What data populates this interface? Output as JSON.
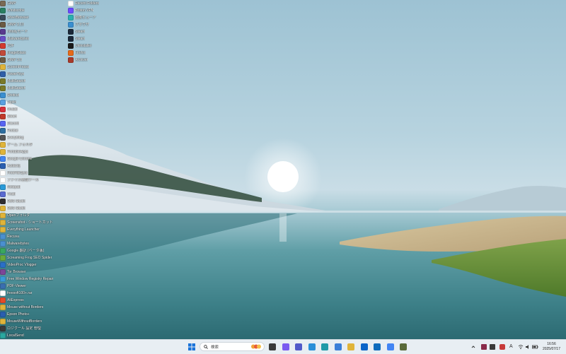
{
  "desktop": {
    "icons_col1": [
      {
        "label": "GIMP",
        "color": "#7a6a55",
        "icon": "gimp-icon"
      },
      {
        "label": "Windscribe",
        "color": "#2a7f62",
        "icon": "app-icon"
      },
      {
        "label": "SilverBrowser",
        "color": "#3a4a5a",
        "icon": "app-icon"
      },
      {
        "label": "GIMP 2.10",
        "color": "#6b5a44",
        "icon": "gimp-icon"
      },
      {
        "label": "Infinityモード",
        "color": "#5a3b8f",
        "icon": "app-icon"
      },
      {
        "label": "Malwarebytes",
        "color": "#6a4fc7",
        "icon": "app-icon"
      },
      {
        "label": "PDF",
        "color": "#d33b2f",
        "icon": "pdf-icon"
      },
      {
        "label": "ImageGlass",
        "color": "#c24a3a",
        "icon": "app-icon"
      },
      {
        "label": "GIMP 3.0",
        "color": "#6b5a44",
        "icon": "gimp-icon"
      },
      {
        "label": "ScreenPresso",
        "color": "#e0b43a",
        "icon": "folder-icon"
      },
      {
        "label": "PowerToys",
        "color": "#2f5fa8",
        "icon": "app-icon"
      },
      {
        "label": "MultiSearch",
        "color": "#7a7a2a",
        "icon": "app-icon"
      },
      {
        "label": "MultiSearch",
        "color": "#7a7a2a",
        "icon": "app-icon"
      },
      {
        "label": "Shotcut",
        "color": "#3a8fd0",
        "icon": "app-icon"
      },
      {
        "label": "Joplin",
        "color": "#5aa0e0",
        "icon": "app-icon"
      },
      {
        "label": "Vivaldi",
        "color": "#d8323c",
        "icon": "app-icon"
      },
      {
        "label": "Steam",
        "color": "#c0392b",
        "icon": "app-icon"
      },
      {
        "label": "Discord",
        "color": "#5865f2",
        "icon": "app-icon"
      },
      {
        "label": "Foobar",
        "color": "#2f6fa0",
        "icon": "app-icon"
      },
      {
        "label": "Everything",
        "color": "#555555",
        "icon": "app-icon"
      },
      {
        "label": "ゲーム フォルダ",
        "color": "#e0b43a",
        "icon": "folder-icon"
      },
      {
        "label": "PortableApps",
        "color": "#e0b43a",
        "icon": "folder-icon"
      },
      {
        "label": "Google Chrome",
        "color": "#4285f4",
        "icon": "chrome-icon"
      },
      {
        "label": "Audacity",
        "color": "#2a5fb0",
        "icon": "app-icon"
      },
      {
        "label": "FreeFileSync",
        "color": "#ffffff",
        "icon": "document-icon"
      },
      {
        "label": "ファイル管理ツール",
        "color": "#ffffff",
        "icon": "document-icon"
      },
      {
        "label": "Notepad",
        "color": "#2a9ad8",
        "icon": "app-icon"
      },
      {
        "label": "Tixati",
        "color": "#5a6ad0",
        "icon": "app-icon"
      },
      {
        "label": "OBS Studio",
        "color": "#302e31",
        "icon": "app-icon"
      },
      {
        "label": "OBS Studio",
        "color": "#e0b43a",
        "icon": "folder-icon"
      },
      {
        "label": "Openフォルダ",
        "color": "#e0b43a",
        "icon": "folder-icon"
      },
      {
        "label": "Screenshot - ショートカット",
        "color": "#e0b43a",
        "icon": "folder-icon"
      },
      {
        "label": "Everything Launcher",
        "color": "#e0b43a",
        "icon": "folder-icon"
      },
      {
        "label": "Recuva",
        "color": "#4a90d0",
        "icon": "app-icon"
      },
      {
        "label": "Malwarebytes",
        "color": "#4a90d0",
        "icon": "app-icon"
      },
      {
        "label": "Google 翻訳 (ベータ版)",
        "color": "#3aa860",
        "icon": "app-icon"
      },
      {
        "label": "Screaming Frog SEO Spider",
        "color": "#6aaa3a",
        "icon": "app-icon"
      },
      {
        "label": "VideoProc Vlogger",
        "color": "#2a6fc8",
        "icon": "app-icon"
      },
      {
        "label": "Tor Browser",
        "color": "#7d4698",
        "icon": "app-icon"
      },
      {
        "label": "Free Window Registry Repair",
        "color": "#3a9ad8",
        "icon": "app-icon"
      },
      {
        "label": "PDF-Viewer",
        "color": "#3a6fb0",
        "icon": "app-icon"
      },
      {
        "label": "freesoft100+.rar",
        "color": "#ffffff",
        "icon": "document-icon"
      },
      {
        "label": "AliExpress",
        "color": "#e64a2a",
        "icon": "app-icon"
      },
      {
        "label": "Mouse without Borders",
        "color": "#e0b43a",
        "icon": "folder-icon"
      },
      {
        "label": "Epson Photo+",
        "color": "#2a5fb0",
        "icon": "app-icon"
      },
      {
        "label": "MouseWithoutBorders",
        "color": "#e0b43a",
        "icon": "folder-icon"
      },
      {
        "label": "ロジクール 設定 管理",
        "color": "#3a3a3a",
        "icon": "app-icon"
      },
      {
        "label": "LocalSend",
        "color": "#2aa8a0",
        "icon": "app-icon"
      }
    ],
    "icons_col2": [
      {
        "label": "Recent Folders",
        "color": "#ffffff",
        "icon": "document-icon"
      },
      {
        "label": "Proton VPN",
        "color": "#6d4aff",
        "icon": "app-icon"
      },
      {
        "label": "画像ビューア",
        "color": "#2ab0b0",
        "icon": "app-icon"
      },
      {
        "label": "ブラウザ",
        "color": "#3a8fd0",
        "icon": "app-icon"
      },
      {
        "label": "Steam",
        "color": "#1b2838",
        "icon": "app-icon"
      },
      {
        "label": "Steam",
        "color": "#1b2838",
        "icon": "app-icon"
      },
      {
        "label": "Uninstaller",
        "color": "#1a1a1a",
        "icon": "app-icon"
      },
      {
        "label": "Firefox",
        "color": "#e66a1a",
        "icon": "app-icon"
      },
      {
        "label": "Archiver",
        "color": "#a83a2a",
        "icon": "app-icon"
      }
    ]
  },
  "taskbar": {
    "search_placeholder": "検索",
    "apps": [
      {
        "icon": "file-explorer-icon",
        "color": "#3a3a3a"
      },
      {
        "icon": "copilot-icon",
        "color": "#7a5af0"
      },
      {
        "icon": "teams-icon",
        "color": "#5059c9"
      },
      {
        "icon": "photos-icon",
        "color": "#2a8fd8"
      },
      {
        "icon": "edge-icon",
        "color": "#1f9aa8"
      },
      {
        "icon": "store-icon",
        "color": "#3a7fd8"
      },
      {
        "icon": "folder-icon",
        "color": "#e0b43a"
      },
      {
        "icon": "mail-icon",
        "color": "#0a64c8"
      },
      {
        "icon": "outlook-icon",
        "color": "#0f6cbd"
      },
      {
        "icon": "chrome-icon",
        "color": "#4285f4"
      },
      {
        "icon": "scissors-icon",
        "color": "#5a6a3a"
      }
    ],
    "tray": {
      "ime_label": "A",
      "time": "16:56",
      "date": "2025/07/17"
    }
  }
}
